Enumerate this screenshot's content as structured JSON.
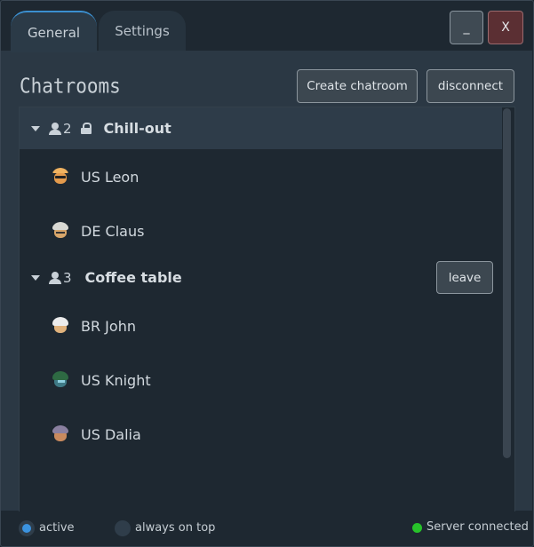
{
  "tabs": [
    {
      "label": "General",
      "active": true
    },
    {
      "label": "Settings",
      "active": false
    }
  ],
  "window_controls": {
    "minimize": "_",
    "close": "X"
  },
  "header": {
    "title": "Chatrooms",
    "create_label": "Create chatroom",
    "disconnect_label": "disconnect"
  },
  "rooms": [
    {
      "count": "2",
      "locked": true,
      "name": "Chill-out",
      "members": [
        {
          "name": "US Leon",
          "avatar": "leon-avatar-icon"
        },
        {
          "name": "DE Claus",
          "avatar": "claus-avatar-icon"
        }
      ]
    },
    {
      "count": "3",
      "locked": false,
      "name": "Coffee table",
      "leave_label": "leave",
      "members": [
        {
          "name": "BR John",
          "avatar": "john-avatar-icon"
        },
        {
          "name": "US Knight",
          "avatar": "knight-avatar-icon"
        },
        {
          "name": "US Dalia",
          "avatar": "dalia-avatar-icon"
        }
      ]
    }
  ],
  "footer": {
    "active_label": "active",
    "active_checked": true,
    "on_top_label": "always on top",
    "on_top_checked": false,
    "status_label": "Server connected",
    "status_color": "#27c22a"
  },
  "colors": {
    "accent": "#3b93e0",
    "close_button": "#5b2f33"
  }
}
